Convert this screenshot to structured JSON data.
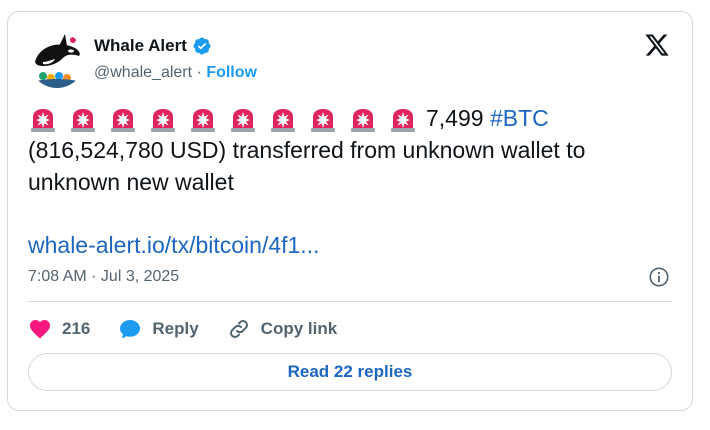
{
  "author": {
    "name": "Whale Alert",
    "handle": "@whale_alert",
    "separator": "·",
    "follow_label": "Follow",
    "verified": true
  },
  "post": {
    "emoji": "siren-emoji",
    "emoji_count": 10,
    "amount": "7,499",
    "hashtag": "#BTC",
    "body": "(816,524,780 USD) transferred from unknown wallet to unknown new wallet",
    "link": "whale-alert.io/tx/bitcoin/4f1...",
    "timestamp": "7:08 AM · Jul 3, 2025"
  },
  "actions": {
    "like_count": "216",
    "reply_label": "Reply",
    "copy_link_label": "Copy link"
  },
  "footer": {
    "read_replies_label": "Read 22 replies"
  },
  "colors": {
    "link_blue": "#1d67c2",
    "verified_blue": "#1d9bf0",
    "heart_pink": "#f91880",
    "muted": "#536471",
    "border": "#cfd9de"
  }
}
